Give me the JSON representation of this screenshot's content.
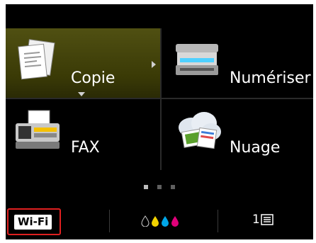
{
  "tiles": [
    {
      "label": "Copie",
      "icon": "copy-icon",
      "selected": true
    },
    {
      "label": "Numériser",
      "icon": "scanner-icon",
      "selected": false
    },
    {
      "label": "FAX",
      "icon": "fax-icon",
      "selected": false
    },
    {
      "label": "Nuage",
      "icon": "cloud-icon",
      "selected": false
    }
  ],
  "pagination": {
    "pages": 3,
    "current": 1
  },
  "status": {
    "wifi_label": "Wi-Fi",
    "ink_colors": [
      "#111111",
      "#f2d200",
      "#00a6e8",
      "#e0007a"
    ],
    "queue_count": "1"
  },
  "colors": {
    "highlight": "#e02020",
    "selected_tile": "#4a4a0e"
  }
}
